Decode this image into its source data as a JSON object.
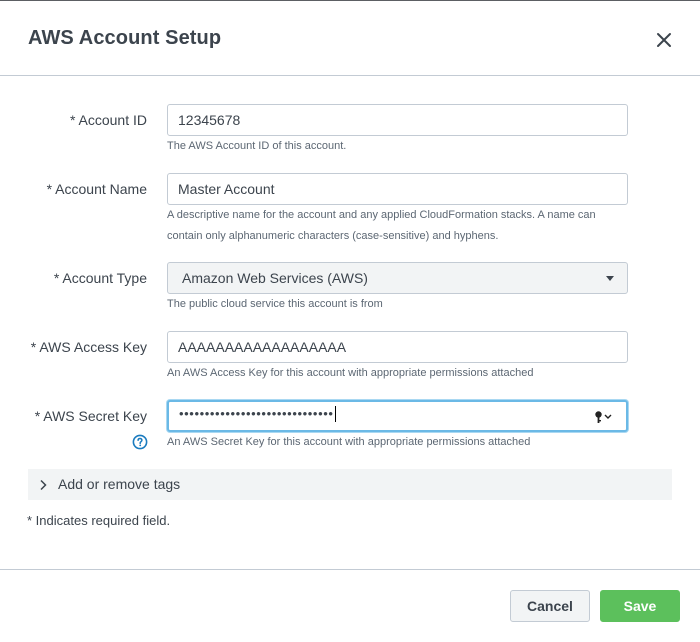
{
  "dialog": {
    "title": "AWS Account Setup",
    "close_icon": "close-icon"
  },
  "form": {
    "account_id": {
      "label": "* Account ID",
      "value": "12345678",
      "help": "The AWS Account ID of this account."
    },
    "account_name": {
      "label": "* Account Name",
      "value": "Master Account",
      "help": "A descriptive name for the account and any applied CloudFormation stacks. A name can contain only alphanumeric characters (case-sensitive) and hyphens."
    },
    "account_type": {
      "label": "* Account Type",
      "selected": "Amazon Web Services (AWS)",
      "help": "The public cloud service this account is from"
    },
    "access_key": {
      "label": "* AWS Access Key",
      "value": "AAAAAAAAAAAAAAAAAA",
      "help": "An AWS Access Key for this account with appropriate permissions attached"
    },
    "secret_key": {
      "label": "* AWS Secret Key",
      "masked_value": "••••••••••••••••••••••••••••••",
      "help": "An AWS Secret Key for this account with appropriate permissions attached",
      "key_icon": "key-icon",
      "help_icon": "question-circle-icon"
    }
  },
  "tags": {
    "label": "Add or remove tags",
    "icon": "chevron-right-icon"
  },
  "required_note": "* Indicates required field.",
  "footer": {
    "cancel_label": "Cancel",
    "save_label": "Save"
  },
  "colors": {
    "save": "#5cc05c",
    "focus": "#6bb9e6",
    "help_icon": "#1a7bbf"
  }
}
